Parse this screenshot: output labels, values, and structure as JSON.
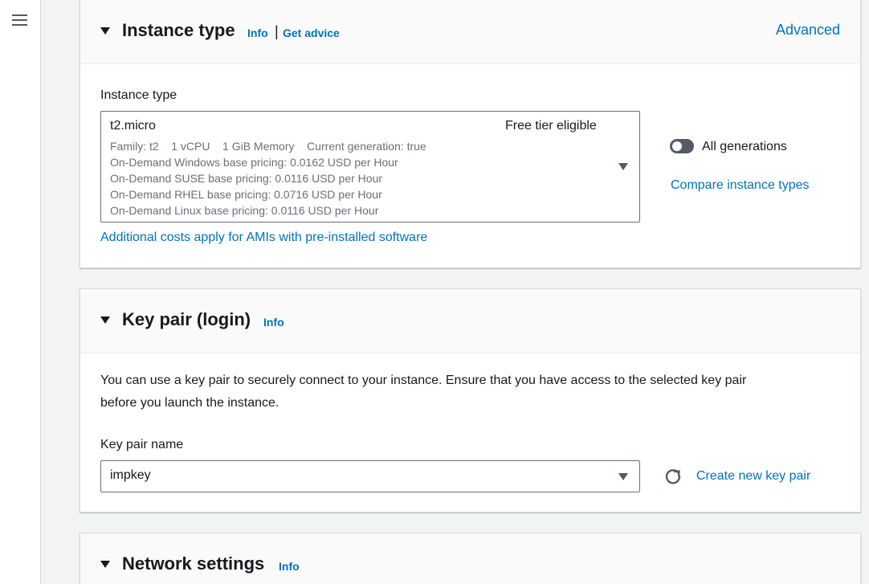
{
  "instance_type_section": {
    "title": "Instance type",
    "info_label": "Info",
    "separator": "|",
    "get_advice_label": "Get advice",
    "advanced_label": "Advanced",
    "field_label": "Instance type",
    "selected": {
      "name": "t2.micro",
      "badge": "Free tier eligible",
      "details": [
        "Family: t2    1 vCPU    1 GiB Memory    Current generation: true",
        "On-Demand Windows base pricing: 0.0162 USD per Hour",
        "On-Demand SUSE base pricing: 0.0116 USD per Hour",
        "On-Demand RHEL base pricing: 0.0716 USD per Hour",
        "On-Demand Linux base pricing: 0.0116 USD per Hour"
      ]
    },
    "additional_costs_link": "Additional costs apply for AMIs with pre-installed software",
    "all_generations_label": "All generations",
    "all_generations_enabled": false,
    "compare_link": "Compare instance types"
  },
  "key_pair_section": {
    "title": "Key pair (login)",
    "info_label": "Info",
    "description_line1": "You can use a key pair to securely connect to your instance. Ensure that you have access to the selected key pair",
    "description_line2": "before you launch the instance.",
    "field_label": "Key pair name",
    "selected_value": "impkey",
    "create_link": "Create new key pair"
  },
  "network_section": {
    "title": "Network settings",
    "info_label": "Info"
  },
  "icons": {
    "menu": "menu-icon",
    "refresh": "refresh-icon",
    "expand": "caret-down-icon"
  },
  "colors": {
    "link": "#0073bb",
    "text": "#16191f",
    "muted": "#687078",
    "background": "#f2f3f3"
  }
}
